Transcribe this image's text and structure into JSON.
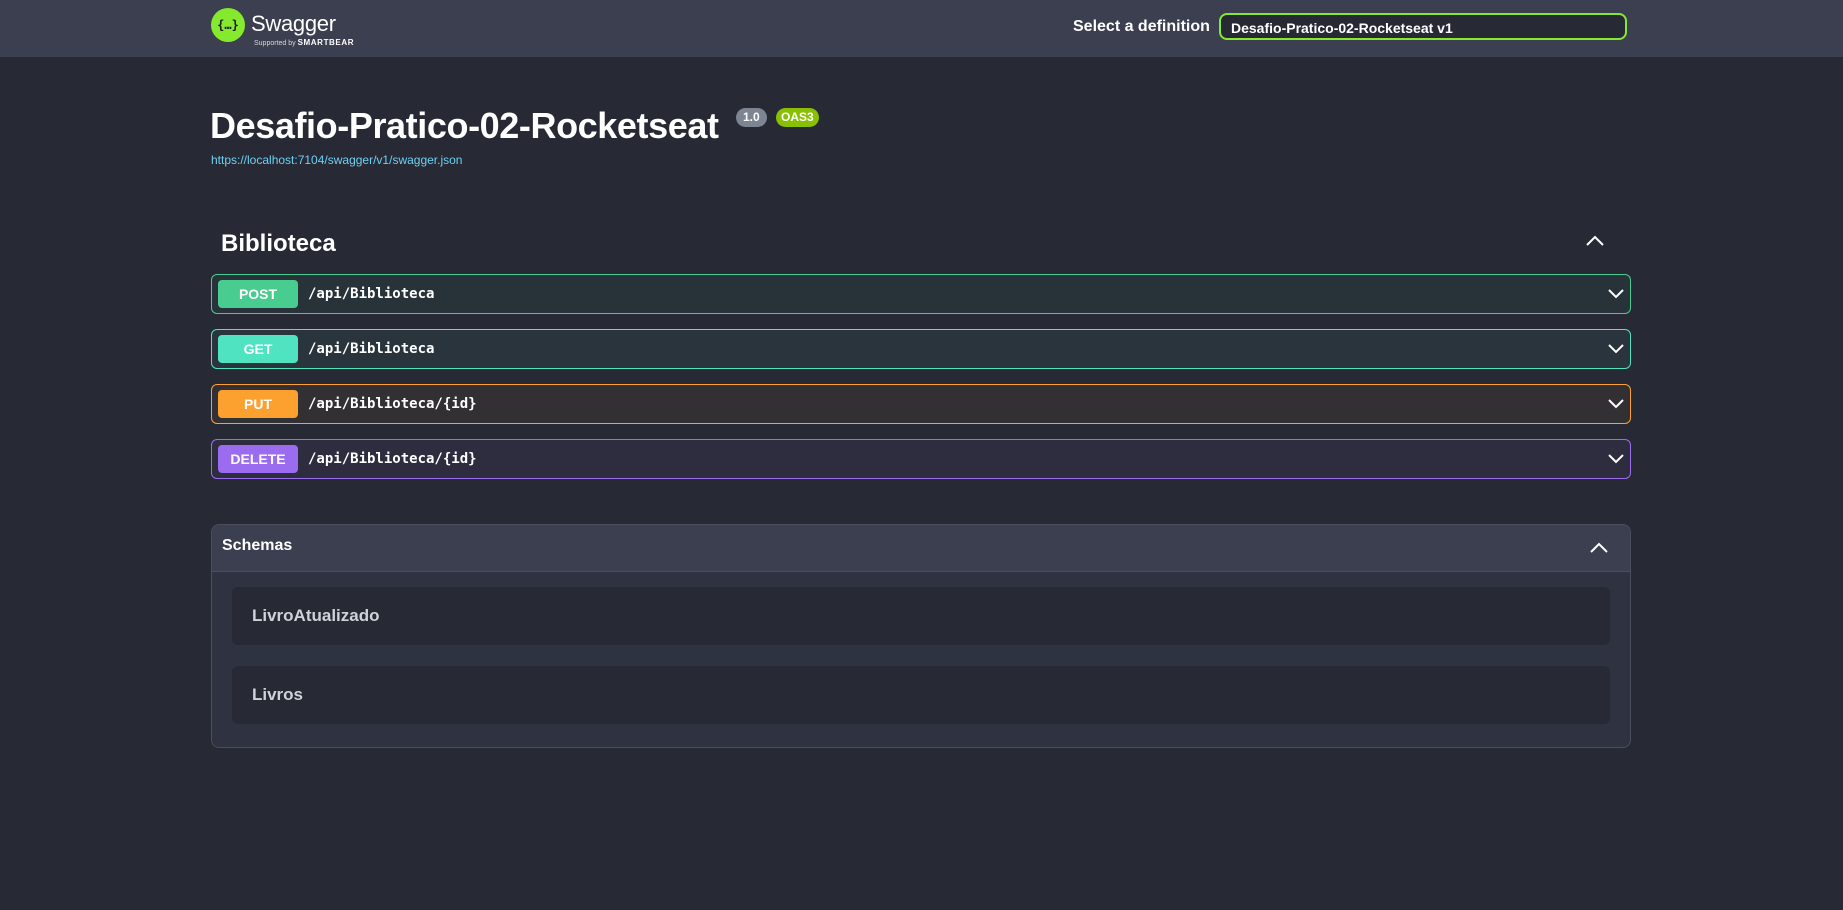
{
  "topbar": {
    "logo_icon": "{…}",
    "logo_name": "Swagger",
    "logo_sub_prefix": "Supported by",
    "logo_sub_brand": "SMARTBEAR",
    "select_label": "Select a definition",
    "select_value": "Desafio-Pratico-02-Rocketseat v1"
  },
  "info": {
    "title": "Desafio-Pratico-02-Rocketseat",
    "version": "1.0",
    "oas_badge": "OAS3",
    "spec_url": "https://localhost:7104/swagger/v1/swagger.json"
  },
  "tag": {
    "name": "Biblioteca",
    "operations": [
      {
        "method": "POST",
        "path": "/api/Biblioteca",
        "color": "#49cc90"
      },
      {
        "method": "GET",
        "path": "/api/Biblioteca",
        "color": "#50e3c2"
      },
      {
        "method": "PUT",
        "path": "/api/Biblioteca/{id}",
        "color": "#fca130"
      },
      {
        "method": "DELETE",
        "path": "/api/Biblioteca/{id}",
        "color": "#9b6cf0"
      }
    ]
  },
  "schemas": {
    "title": "Schemas",
    "models": [
      "LivroAtualizado",
      "Livros"
    ]
  },
  "colors": {
    "accent": "#85ea2d",
    "background": "#272a35",
    "topbar": "#3b3f4f"
  }
}
